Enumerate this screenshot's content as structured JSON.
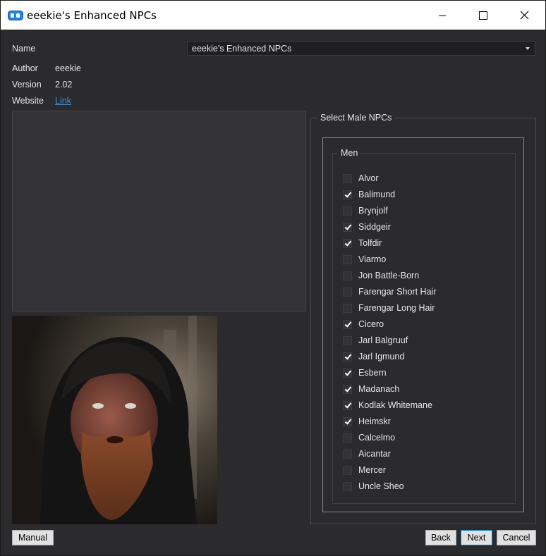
{
  "window": {
    "title": "eeekie's Enhanced NPCs"
  },
  "fields": {
    "name_label": "Name",
    "name_value": "eeekie's Enhanced NPCs",
    "author_label": "Author",
    "author_value": "eeekie",
    "version_label": "Version",
    "version_value": "2.02",
    "website_label": "Website",
    "website_link": "Link"
  },
  "group": {
    "title": "Select Male NPCs",
    "inner_title": "Men",
    "items": [
      {
        "label": "Alvor",
        "checked": false
      },
      {
        "label": "Balimund",
        "checked": true
      },
      {
        "label": "Brynjolf",
        "checked": false
      },
      {
        "label": "Siddgeir",
        "checked": true
      },
      {
        "label": "Tolfdir",
        "checked": true
      },
      {
        "label": "Viarmo",
        "checked": false
      },
      {
        "label": "Jon Battle-Born",
        "checked": false
      },
      {
        "label": "Farengar Short Hair",
        "checked": false
      },
      {
        "label": "Farengar Long Hair",
        "checked": false
      },
      {
        "label": "Cicero",
        "checked": true
      },
      {
        "label": "Jarl Balgruuf",
        "checked": false
      },
      {
        "label": "Jarl Igmund",
        "checked": true
      },
      {
        "label": "Esbern",
        "checked": true
      },
      {
        "label": "Madanach",
        "checked": true
      },
      {
        "label": "Kodlak Whitemane",
        "checked": true
      },
      {
        "label": "Heimskr",
        "checked": true
      },
      {
        "label": "Calcelmo",
        "checked": false
      },
      {
        "label": "Aicantar",
        "checked": false
      },
      {
        "label": "Mercer",
        "checked": false
      },
      {
        "label": "Uncle Sheo",
        "checked": false
      }
    ]
  },
  "buttons": {
    "manual": "Manual",
    "back": "Back",
    "next": "Next",
    "cancel": "Cancel"
  },
  "colors": {
    "accent": "#0078d7",
    "link": "#3b8edb",
    "background": "#2b2b2e"
  }
}
